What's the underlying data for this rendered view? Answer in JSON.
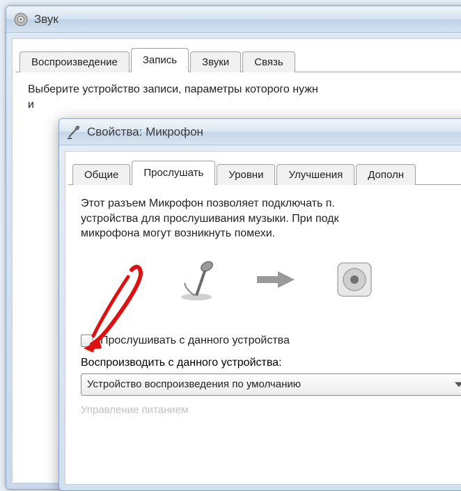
{
  "outerWindow": {
    "title": "Звук",
    "tabs": [
      {
        "label": "Воспроизведение",
        "active": false
      },
      {
        "label": "Запись",
        "active": true
      },
      {
        "label": "Звуки",
        "active": false
      },
      {
        "label": "Связь",
        "active": false
      }
    ],
    "instruction": "Выберите устройство записи, параметры которого нужн",
    "instructionLine2": "и"
  },
  "innerWindow": {
    "title": "Свойства: Микрофон",
    "tabs": [
      {
        "label": "Общие",
        "active": false
      },
      {
        "label": "Прослушать",
        "active": true
      },
      {
        "label": "Уровни",
        "active": false
      },
      {
        "label": "Улучшения",
        "active": false
      },
      {
        "label": "Дополн",
        "active": false
      }
    ],
    "description": "Этот разъем Микрофон позволяет подключать п.\nустройства для прослушивания музыки. При подк\nмикрофона могут возникнуть помехи.",
    "checkboxLabel": "Прослушивать с данного устройства",
    "playbackLabel": "Воспроизводить с данного устройства:",
    "dropdownValue": "Устройство воспроизведения по умолчанию",
    "bottomCut": "Управление питанием"
  }
}
